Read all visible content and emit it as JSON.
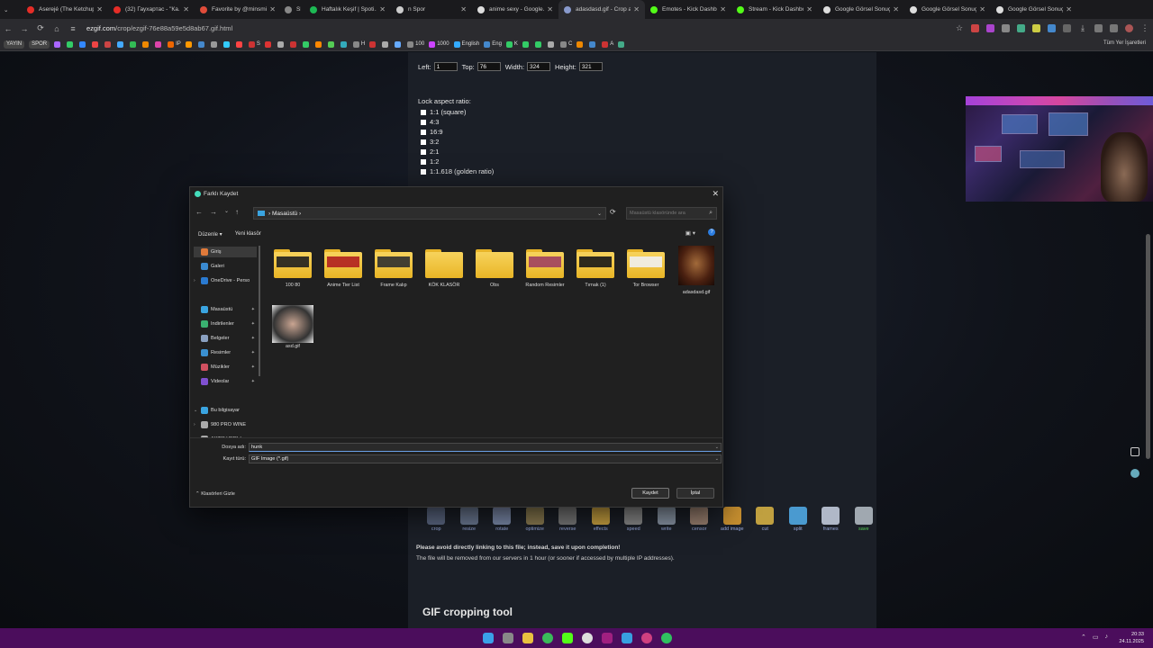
{
  "browser": {
    "tabs": [
      {
        "title": "Aserejé (The Ketchup...",
        "color": "#e52d27"
      },
      {
        "title": "(32) Гаухартас - \"Ка...",
        "color": "#e52d27"
      },
      {
        "title": "Favorite by @minsmi...",
        "color": "#e04c3a"
      },
      {
        "title": "SPOR",
        "color": "#888888"
      },
      {
        "title": "Haftalık Keşif | Spoti...",
        "color": "#1db954"
      },
      {
        "title": "n Spor",
        "color": "#cccccc"
      },
      {
        "title": "anime sexy - Google...",
        "color": "#dddddd"
      },
      {
        "title": "adasdasd.gif - Crop a...",
        "color": "#8899cc"
      },
      {
        "title": "Emotes - Kick Dashb...",
        "color": "#53fc18"
      },
      {
        "title": "Stream - Kick Dashbo...",
        "color": "#53fc18"
      },
      {
        "title": "Google Görsel Sonuç...",
        "color": "#dddddd"
      },
      {
        "title": "Google Görsel Sonuç...",
        "color": "#dddddd"
      },
      {
        "title": "Google Görsel Sonuç...",
        "color": "#dddddd"
      }
    ],
    "url_host": "ezgif.com",
    "url_path": "/crop/ezgif-76e88a59e5d8ab67.gif.html",
    "bookmarks": [
      "YAYIN",
      "SPOR",
      "IP",
      "S",
      "H",
      "100",
      "1000",
      "English",
      "Eng",
      "K",
      "C",
      "A"
    ],
    "all_bookmarks": "Tüm Yer İşaretleri"
  },
  "crop": {
    "left_label": "Left:",
    "left_value": "1",
    "top_label": "Top:",
    "top_value": "76",
    "width_label": "Width:",
    "width_value": "324",
    "height_label": "Height:",
    "height_value": "321",
    "ratio_title": "Lock aspect ratio:",
    "ratios": [
      "1:1 (square)",
      "4:3",
      "16:9",
      "3:2",
      "2:1",
      "1:2",
      "1:1.618 (golden ratio)"
    ]
  },
  "tools": [
    {
      "label": "crop",
      "color": "#5a6680"
    },
    {
      "label": "resize",
      "color": "#6a7890"
    },
    {
      "label": "rotate",
      "color": "#7a88a8"
    },
    {
      "label": "optimize",
      "color": "#8a7a50"
    },
    {
      "label": "reverse",
      "color": "#777777"
    },
    {
      "label": "effects",
      "color": "#c8a040"
    },
    {
      "label": "speed",
      "color": "#888888"
    },
    {
      "label": "write",
      "color": "#8894a4"
    },
    {
      "label": "censor",
      "color": "#9a8070"
    },
    {
      "label": "add image",
      "color": "#c89030"
    },
    {
      "label": "cut",
      "color": "#c0a040"
    },
    {
      "label": "split",
      "color": "#4a9ad0"
    },
    {
      "label": "frames",
      "color": "#b0b8c8"
    },
    {
      "label": "save",
      "color": "#a0a8b0"
    }
  ],
  "notice_bold": "Please avoid directly linking to this file; instead, save it upon completion!",
  "notice": "The file will be removed from our servers in 1 hour (or sooner if accessed by multiple IP addresses).",
  "section_title": "GIF cropping tool",
  "dialog": {
    "title": "Farklı Kaydet",
    "path": "Masaüstü",
    "search_placeholder": "Masaüstü klasöründe ara",
    "organize": "Düzenle",
    "new_folder": "Yeni klasör",
    "nav": [
      {
        "label": "Giriş",
        "color": "#e07a3a",
        "selected": true
      },
      {
        "label": "Galeri",
        "color": "#3a8ad0"
      },
      {
        "label": "OneDrive - Perso",
        "color": "#2a7ad0",
        "arrow": "›"
      },
      {
        "label": "Masaüstü",
        "color": "#3aa4e0",
        "pinned": true
      },
      {
        "label": "İndirilenler",
        "color": "#3ab070",
        "pinned": true
      },
      {
        "label": "Belgeler",
        "color": "#8aa0c0",
        "pinned": true
      },
      {
        "label": "Resimler",
        "color": "#3a90d0",
        "pinned": true
      },
      {
        "label": "Müzikler",
        "color": "#d05060",
        "pinned": true
      },
      {
        "label": "Videolar",
        "color": "#8050d0",
        "pinned": true
      },
      {
        "label": "Bu bilgisayar",
        "color": "#3aa4e0",
        "arrow": "⌄"
      },
      {
        "label": "980 PRO WİNE",
        "color": "#aaaaaa",
        "arrow": "›"
      },
      {
        "label": "AKTİF VERİ (",
        "color": "#aaaaaa",
        "arrow": "›"
      }
    ],
    "files": [
      {
        "name": "100 80",
        "kind": "folder",
        "preview": "#202020"
      },
      {
        "name": "Anime Tier List",
        "kind": "folder",
        "preview": "#b02020"
      },
      {
        "name": "Frame Kalıp",
        "kind": "folder",
        "preview": "#303030"
      },
      {
        "name": "KÖK KLASÖR",
        "kind": "folder",
        "preview": ""
      },
      {
        "name": "Obs",
        "kind": "folder",
        "preview": ""
      },
      {
        "name": "Random Resimler",
        "kind": "folder",
        "preview": "#a04060"
      },
      {
        "name": "Tırnak (1)",
        "kind": "folder",
        "preview": "#181818"
      },
      {
        "name": "Tor Browser",
        "kind": "folder",
        "preview": "#f0f0f0"
      },
      {
        "name": "adasdasd.gif",
        "kind": "image",
        "preview": ""
      },
      {
        "name": "asd.gif",
        "kind": "image2",
        "preview": ""
      }
    ],
    "filename_label": "Dosya adı:",
    "filename_value": "hunk",
    "filetype_label": "Kayıt türü:",
    "filetype_value": "GIF Image (*.gif)",
    "hide_folders": "Klasörleri Gizle",
    "save": "Kaydet",
    "cancel": "İptal"
  },
  "clock": {
    "time": "20:33",
    "date": "24.11.2025"
  }
}
